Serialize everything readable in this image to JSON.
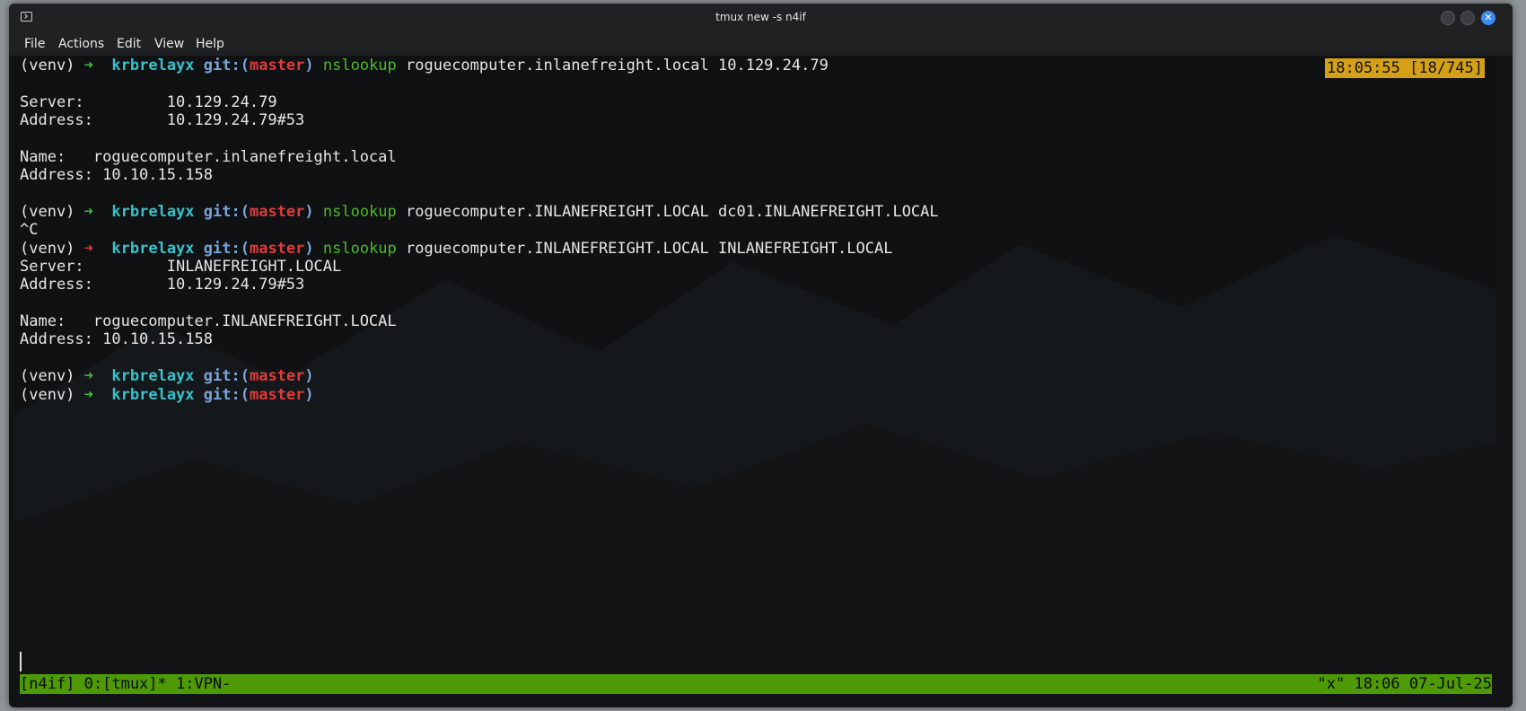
{
  "window": {
    "title": "tmux new -s n4if",
    "icons": [
      "terminal-icon",
      "minimize-icon",
      "maximize-icon",
      "close-icon"
    ]
  },
  "menu": [
    "File",
    "Actions",
    "Edit",
    "View",
    "Help"
  ],
  "clock": "18:05:55 [18/745]",
  "prompt": {
    "venv": "(venv)",
    "arrow": "➜",
    "dir": "krbrelayx",
    "git_open": "git:(",
    "branch": "master",
    "git_close": ")"
  },
  "commands": [
    {
      "cmd": "nslookup",
      "args": " roguecomputer.inlanefreight.local 10.129.24.79"
    },
    {
      "cmd": "nslookup",
      "args": " roguecomputer.INLANEFREIGHT.LOCAL dc01.INLANEFREIGHT.LOCAL"
    },
    {
      "cmd": "nslookup",
      "args": " roguecomputer.INLANEFREIGHT.LOCAL INLANEFREIGHT.LOCAL"
    }
  ],
  "output": {
    "block1": [
      "Server:         10.129.24.79",
      "Address:        10.129.24.79#53",
      "",
      "Name:   roguecomputer.inlanefreight.local",
      "Address: 10.10.15.158"
    ],
    "interrupt": "^C",
    "block2": [
      "Server:         INLANEFREIGHT.LOCAL",
      "Address:        10.129.24.79#53",
      "",
      "Name:   roguecomputer.INLANEFREIGHT.LOCAL",
      "Address: 10.10.15.158"
    ]
  },
  "status": {
    "left": "[n4if] 0:[tmux]* 1:VPN-",
    "right": "\"x\" 18:06 07-Jul-25"
  },
  "colors": {
    "status_bg": "#4e9a06",
    "clock_bg": "#d4a017",
    "arrow_ok": "#3fbf3f",
    "arrow_err": "#e03a3a",
    "dir": "#37c1c9",
    "branch": "#e03a3a",
    "cmd": "#4cb82b"
  }
}
